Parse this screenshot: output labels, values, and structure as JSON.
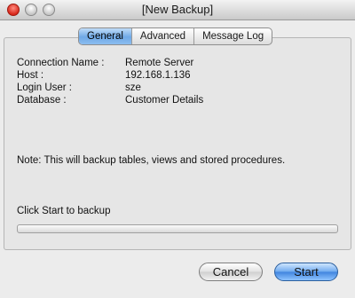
{
  "window": {
    "title": "[New Backup]"
  },
  "tabs": [
    {
      "label": "General",
      "active": true
    },
    {
      "label": "Advanced",
      "active": false
    },
    {
      "label": "Message Log",
      "active": false
    }
  ],
  "details": [
    {
      "key": "Connection Name :",
      "value": "Remote Server"
    },
    {
      "key": "Host :",
      "value": "192.168.1.136"
    },
    {
      "key": "Login User :",
      "value": "sze"
    },
    {
      "key": "Database :",
      "value": "Customer Details"
    }
  ],
  "note": "Note: This will backup tables, views and stored procedures.",
  "status": "Click Start to backup",
  "progress": {
    "fraction": 0
  },
  "buttons": {
    "cancel": "Cancel",
    "start": "Start"
  }
}
